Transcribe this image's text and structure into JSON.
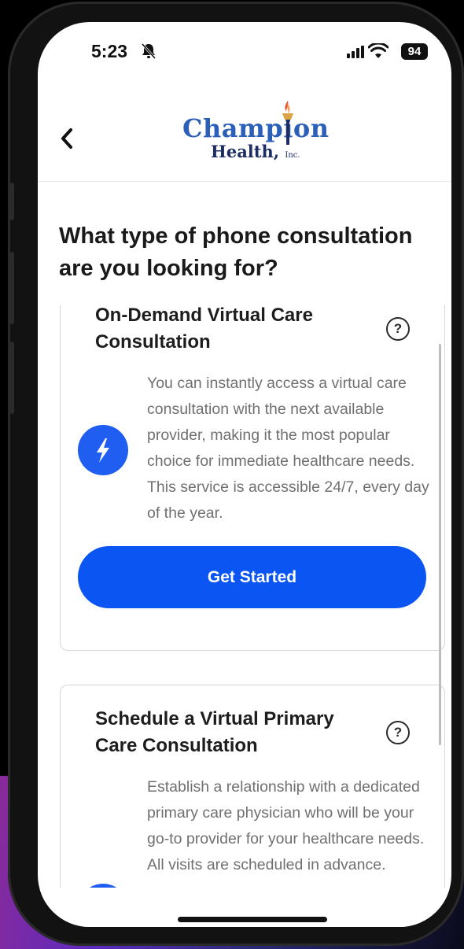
{
  "status_bar": {
    "time": "5:23",
    "battery": "94",
    "icons": [
      "bell-slash-icon",
      "signal-icon",
      "wifi-icon"
    ]
  },
  "header": {
    "back_icon": "chevron-left-icon",
    "logo_line1": "Champion",
    "logo_line2": "Health,",
    "logo_suffix": "Inc."
  },
  "question": "What type of phone consultation are you looking for?",
  "options": [
    {
      "title": "On-Demand Virtual Care Consultation",
      "description": "You can instantly access a virtual care consultation with the next available provider, making it the most popular choice for immediate healthcare needs. This service is accessible 24/7, every day of the year.",
      "icon": "lightning-bolt-icon",
      "button_label": "Get Started"
    },
    {
      "title": "Schedule a Virtual Primary Care Consultation",
      "description": "Establish a relationship with a dedicated primary care physician who will be your go-to provider for your healthcare needs. All visits are scheduled in advance.",
      "icon": "calendar-icon"
    }
  ],
  "colors": {
    "accent": "#0b55f2",
    "logo_blue": "#2c5fb8",
    "logo_navy": "#1c2d63",
    "muted_text": "#707070"
  }
}
